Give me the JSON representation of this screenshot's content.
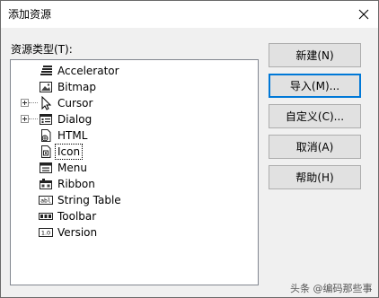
{
  "window": {
    "title": "添加资源"
  },
  "tree": {
    "label": "资源类型(T):",
    "items": [
      {
        "label": "Accelerator",
        "icon": "accelerator-icon",
        "expandable": false,
        "selected": false
      },
      {
        "label": "Bitmap",
        "icon": "bitmap-icon",
        "expandable": false,
        "selected": false
      },
      {
        "label": "Cursor",
        "icon": "cursor-icon",
        "expandable": true,
        "selected": false
      },
      {
        "label": "Dialog",
        "icon": "dialog-icon",
        "expandable": true,
        "selected": false
      },
      {
        "label": "HTML",
        "icon": "html-icon",
        "expandable": false,
        "selected": false
      },
      {
        "label": "Icon",
        "icon": "icon-resource-icon",
        "expandable": false,
        "selected": true
      },
      {
        "label": "Menu",
        "icon": "menu-icon",
        "expandable": false,
        "selected": false
      },
      {
        "label": "Ribbon",
        "icon": "ribbon-icon",
        "expandable": false,
        "selected": false
      },
      {
        "label": "String Table",
        "icon": "string-table-icon",
        "expandable": false,
        "selected": false
      },
      {
        "label": "Toolbar",
        "icon": "toolbar-icon",
        "expandable": false,
        "selected": false
      },
      {
        "label": "Version",
        "icon": "version-icon",
        "expandable": false,
        "selected": false
      }
    ]
  },
  "buttons": {
    "new_label": "新建(N)",
    "import_label": "导入(M)...",
    "custom_label": "自定义(C)...",
    "cancel_label": "取消(A)",
    "help_label": "帮助(H)"
  },
  "watermark": "头条 @编码那些事",
  "colors": {
    "default_button_border": "#0078d7",
    "tree_border": "#828790"
  }
}
